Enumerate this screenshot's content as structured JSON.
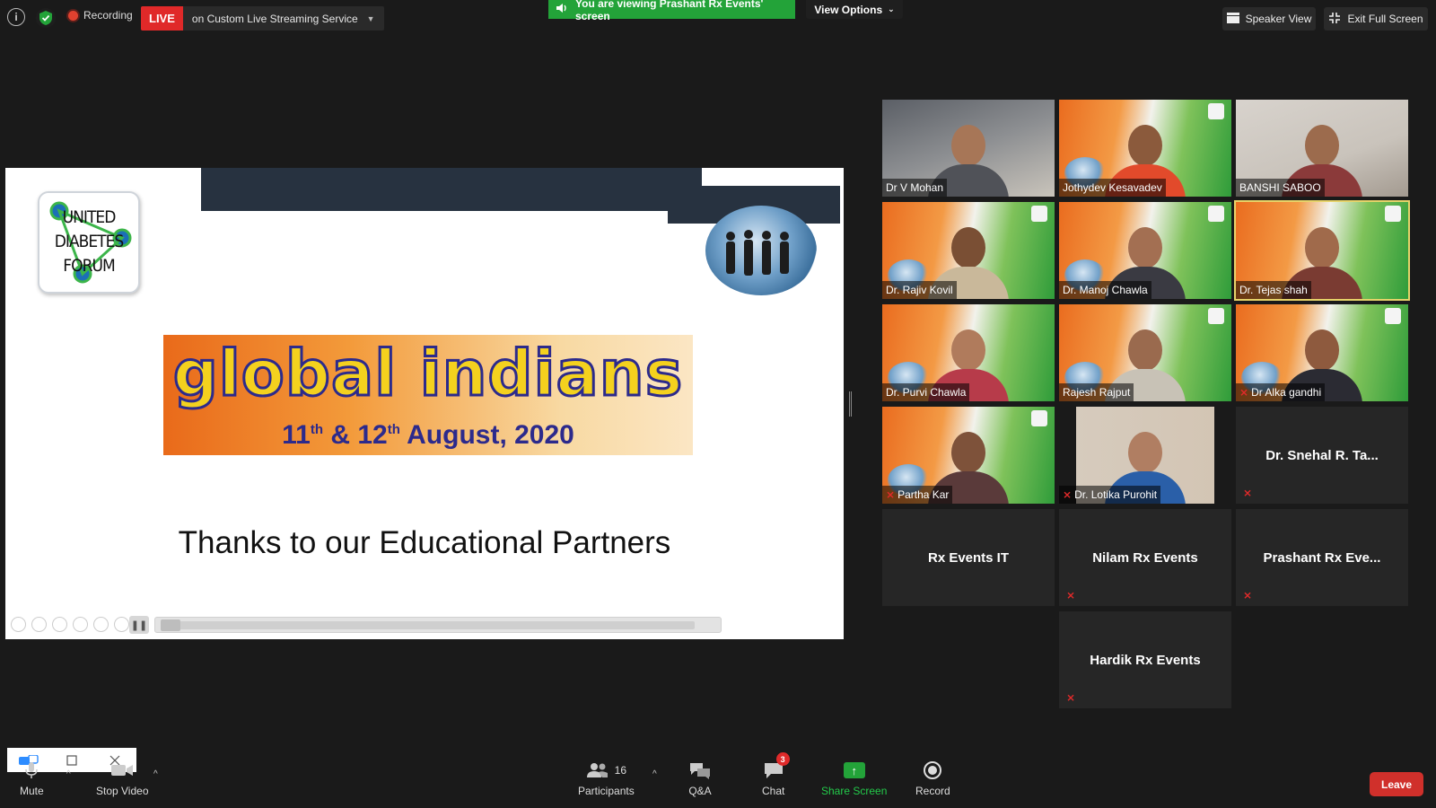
{
  "topbar": {
    "recording_label": "Recording",
    "live_label": "LIVE",
    "stream_service": "on Custom Live Streaming Service",
    "viewing_banner": "You are viewing Prashant Rx Events' screen",
    "view_options": "View Options",
    "speaker_view": "Speaker View",
    "exit_full_screen": "Exit Full Screen"
  },
  "slide": {
    "logo_text_1": "UNITED",
    "logo_text_2": "DIABETES",
    "logo_text_3": "FORUM",
    "banner_title": "global indians",
    "banner_date_d1": "11",
    "banner_date_sup1": "th",
    "banner_date_mid": " & 12",
    "banner_date_sup2": "th",
    "banner_date_end": " August, 2020",
    "thanks_text": "Thanks to our Educational Partners"
  },
  "participants": [
    {
      "name": "Dr V Mohan",
      "muted": false
    },
    {
      "name": "Jothydev Kesavadev",
      "muted": false
    },
    {
      "name": "BANSHI SABOO",
      "muted": false
    },
    {
      "name": "Dr. Rajiv Kovil",
      "muted": false
    },
    {
      "name": "Dr. Manoj Chawla",
      "muted": false
    },
    {
      "name": "Dr. Tejas shah",
      "muted": false
    },
    {
      "name": "Dr. Purvi Chawla",
      "muted": false
    },
    {
      "name": "Rajesh Rajput",
      "muted": false
    },
    {
      "name": "Dr Alka gandhi",
      "muted": true
    },
    {
      "name": "Partha Kar",
      "muted": true
    },
    {
      "name": "Dr. Lotika Purohit",
      "muted": true
    },
    {
      "name": "Dr. Snehal R. Ta...",
      "muted": true
    },
    {
      "name": "Rx Events IT",
      "muted": false
    },
    {
      "name": "Nilam Rx Events",
      "muted": true
    },
    {
      "name": "Prashant Rx Eve...",
      "muted": true
    },
    {
      "name": "Hardik Rx Events",
      "muted": true
    }
  ],
  "toolbar": {
    "mute": "Mute",
    "stop_video": "Stop Video",
    "participants_count": "16",
    "participants": "Participants",
    "qa": "Q&A",
    "chat": "Chat",
    "chat_badge": "3",
    "share_screen": "Share Screen",
    "record": "Record",
    "leave": "Leave"
  },
  "colors": {
    "live_red": "#e02929",
    "share_green": "#23a339",
    "active_speaker_outline": "#e6d36a",
    "leave_red": "#d0302b"
  }
}
